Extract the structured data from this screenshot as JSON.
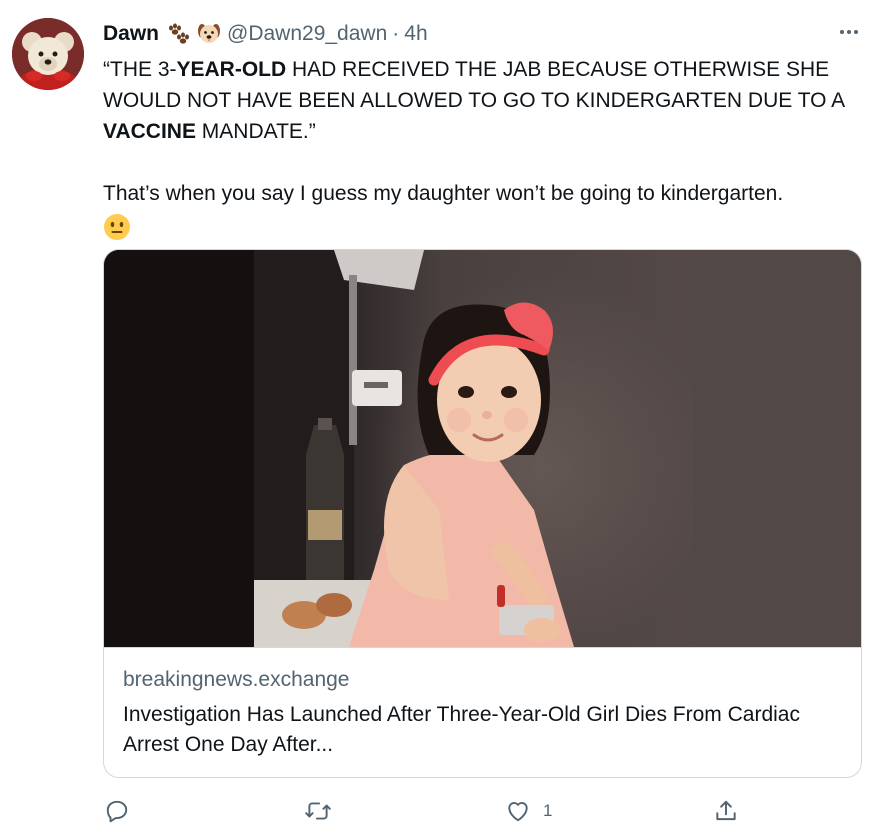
{
  "tweet": {
    "author": {
      "name": "Dawn",
      "emoji": [
        "paw-prints-emoji",
        "dog-face-emoji"
      ],
      "handle": "@Dawn29_dawn",
      "separator": "·",
      "time": "4h"
    },
    "text": {
      "quote_line": [
        {
          "text": "“THE 3-",
          "bold": false
        },
        {
          "text": "YEAR-OLD",
          "bold": true
        },
        {
          "text": " HAD RECEIVED THE JAB BECAUSE OTHERWISE SHE WOULD NOT HAVE BEEN ALLOWED TO GO TO KINDERGARTEN DUE TO A ",
          "bold": false
        },
        {
          "text": "VACCINE",
          "bold": true
        },
        {
          "text": " MANDATE.”",
          "bold": false
        }
      ],
      "comment": "That’s when you say I guess my daughter won’t be going to kindergarten.",
      "comment_emoji": "neutral-face-emoji"
    },
    "card": {
      "domain": "breakingnews.exchange",
      "title": "Investigation Has Launched After Three-Year-Old Girl Dies From Cardiac Arrest One Day After..."
    },
    "actions": {
      "reply_icon": "reply-icon",
      "retweet_icon": "retweet-icon",
      "like_icon": "heart-icon",
      "like_count": "1",
      "share_icon": "share-icon"
    }
  },
  "colors": {
    "text_primary": "#0f1419",
    "text_secondary": "#536471",
    "border": "#cfd9de"
  }
}
